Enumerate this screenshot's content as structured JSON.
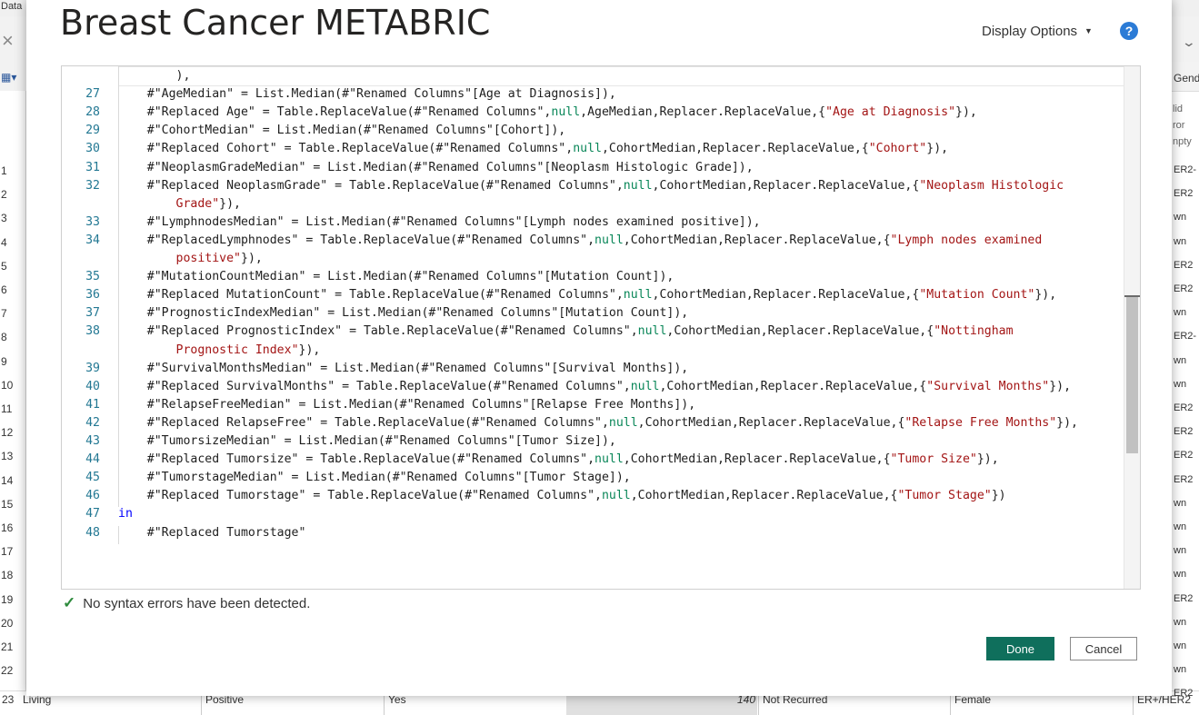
{
  "background": {
    "topbar_label": "Data",
    "close_glyph": "×",
    "table_icon": "▦▾",
    "row_numbers": [
      "1",
      "2",
      "3",
      "4",
      "5",
      "6",
      "7",
      "8",
      "9",
      "10",
      "11",
      "12",
      "13",
      "14",
      "15",
      "16",
      "17",
      "18",
      "19",
      "20",
      "21",
      "22"
    ],
    "right_column_header": "Gend",
    "right_column_mini": [
      "lid",
      "ror",
      "npty"
    ],
    "right_column_cells": [
      "ER2-",
      "ER2",
      "wn",
      "wn",
      "ER2",
      "ER2",
      "wn",
      "ER2-",
      "wn",
      "wn",
      "ER2",
      "ER2",
      "ER2",
      "ER2",
      "wn",
      "wn",
      "wn",
      "wn",
      "ER2",
      "wn",
      "wn",
      "wn",
      "ER2"
    ],
    "bottom_row": {
      "row_number": "23",
      "status": "Living",
      "receptor": "Positive",
      "flag": "Yes",
      "value": "140",
      "recurrence": "Not Recurred",
      "sex": "Female",
      "subtype": "ER+/HER2"
    }
  },
  "dialog": {
    "title": "Breast Cancer METABRIC",
    "display_options_label": "Display Options",
    "help_label": "?",
    "status_text": "No syntax errors have been detected.",
    "done_label": "Done",
    "cancel_label": "Cancel",
    "code_lines": [
      {
        "n": "",
        "parts": [
          [
            "        ),",
            ""
          ]
        ]
      },
      {
        "n": "27",
        "parts": [
          [
            "    #\"AgeMedian\" = List.Median(#\"Renamed Columns\"[Age at Diagnosis]),",
            ""
          ]
        ]
      },
      {
        "n": "28",
        "parts": [
          [
            "    #\"Replaced Age\" = Table.ReplaceValue(#\"Renamed Columns\",",
            ""
          ],
          [
            "null",
            "nl"
          ],
          [
            ",AgeMedian,Replacer.ReplaceValue,{",
            ""
          ],
          [
            "\"Age at Diagnosis\"",
            "st"
          ],
          [
            "}),",
            ""
          ]
        ]
      },
      {
        "n": "29",
        "parts": [
          [
            "    #\"CohortMedian\" = List.Median(#\"Renamed Columns\"[Cohort]),",
            ""
          ]
        ]
      },
      {
        "n": "30",
        "parts": [
          [
            "    #\"Replaced Cohort\" = Table.ReplaceValue(#\"Renamed Columns\",",
            ""
          ],
          [
            "null",
            "nl"
          ],
          [
            ",CohortMedian,Replacer.ReplaceValue,{",
            ""
          ],
          [
            "\"Cohort\"",
            "st"
          ],
          [
            "}),",
            ""
          ]
        ]
      },
      {
        "n": "31",
        "parts": [
          [
            "    #\"NeoplasmGradeMedian\" = List.Median(#\"Renamed Columns\"[Neoplasm Histologic Grade]),",
            ""
          ]
        ]
      },
      {
        "n": "32",
        "parts": [
          [
            "    #\"Replaced NeoplasmGrade\" = Table.ReplaceValue(#\"Renamed Columns\",",
            ""
          ],
          [
            "null",
            "nl"
          ],
          [
            ",CohortMedian,Replacer.ReplaceValue,{",
            ""
          ],
          [
            "\"Neoplasm Histologic",
            "st"
          ]
        ]
      },
      {
        "n": "",
        "parts": [
          [
            "        ",
            ""
          ],
          [
            "Grade\"",
            "st"
          ],
          [
            "}),",
            ""
          ]
        ]
      },
      {
        "n": "33",
        "parts": [
          [
            "    #\"LymphnodesMedian\" = List.Median(#\"Renamed Columns\"[Lymph nodes examined positive]),",
            ""
          ]
        ]
      },
      {
        "n": "34",
        "parts": [
          [
            "    #\"ReplacedLymphnodes\" = Table.ReplaceValue(#\"Renamed Columns\",",
            ""
          ],
          [
            "null",
            "nl"
          ],
          [
            ",CohortMedian,Replacer.ReplaceValue,{",
            ""
          ],
          [
            "\"Lymph nodes examined",
            "st"
          ]
        ]
      },
      {
        "n": "",
        "parts": [
          [
            "        ",
            ""
          ],
          [
            "positive\"",
            "st"
          ],
          [
            "}),",
            ""
          ]
        ]
      },
      {
        "n": "35",
        "parts": [
          [
            "    #\"MutationCountMedian\" = List.Median(#\"Renamed Columns\"[Mutation Count]),",
            ""
          ]
        ]
      },
      {
        "n": "36",
        "parts": [
          [
            "    #\"Replaced MutationCount\" = Table.ReplaceValue(#\"Renamed Columns\",",
            ""
          ],
          [
            "null",
            "nl"
          ],
          [
            ",CohortMedian,Replacer.ReplaceValue,{",
            ""
          ],
          [
            "\"Mutation Count\"",
            "st"
          ],
          [
            "}),",
            ""
          ]
        ]
      },
      {
        "n": "37",
        "parts": [
          [
            "    #\"PrognosticIndexMedian\" = List.Median(#\"Renamed Columns\"[Mutation Count]),",
            ""
          ]
        ]
      },
      {
        "n": "38",
        "parts": [
          [
            "    #\"Replaced PrognosticIndex\" = Table.ReplaceValue(#\"Renamed Columns\",",
            ""
          ],
          [
            "null",
            "nl"
          ],
          [
            ",CohortMedian,Replacer.ReplaceValue,{",
            ""
          ],
          [
            "\"Nottingham",
            "st"
          ]
        ]
      },
      {
        "n": "",
        "parts": [
          [
            "        ",
            ""
          ],
          [
            "Prognostic Index\"",
            "st"
          ],
          [
            "}),",
            ""
          ]
        ]
      },
      {
        "n": "39",
        "parts": [
          [
            "    #\"SurvivalMonthsMedian\" = List.Median(#\"Renamed Columns\"[Survival Months]),",
            ""
          ]
        ]
      },
      {
        "n": "40",
        "parts": [
          [
            "    #\"Replaced SurvivalMonths\" = Table.ReplaceValue(#\"Renamed Columns\",",
            ""
          ],
          [
            "null",
            "nl"
          ],
          [
            ",CohortMedian,Replacer.ReplaceValue,{",
            ""
          ],
          [
            "\"Survival Months\"",
            "st"
          ],
          [
            "}),",
            ""
          ]
        ]
      },
      {
        "n": "41",
        "parts": [
          [
            "    #\"RelapseFreeMedian\" = List.Median(#\"Renamed Columns\"[Relapse Free Months]),",
            ""
          ]
        ]
      },
      {
        "n": "42",
        "parts": [
          [
            "    #\"Replaced RelapseFree\" = Table.ReplaceValue(#\"Renamed Columns\",",
            ""
          ],
          [
            "null",
            "nl"
          ],
          [
            ",CohortMedian,Replacer.ReplaceValue,{",
            ""
          ],
          [
            "\"Relapse Free Months\"",
            "st"
          ],
          [
            "}),",
            ""
          ]
        ]
      },
      {
        "n": "43",
        "parts": [
          [
            "    #\"TumorsizeMedian\" = List.Median(#\"Renamed Columns\"[Tumor Size]),",
            ""
          ]
        ]
      },
      {
        "n": "44",
        "parts": [
          [
            "    #\"Replaced Tumorsize\" = Table.ReplaceValue(#\"Renamed Columns\",",
            ""
          ],
          [
            "null",
            "nl"
          ],
          [
            ",CohortMedian,Replacer.ReplaceValue,{",
            ""
          ],
          [
            "\"Tumor Size\"",
            "st"
          ],
          [
            "}),",
            ""
          ]
        ]
      },
      {
        "n": "45",
        "parts": [
          [
            "    #\"TumorstageMedian\" = List.Median(#\"Renamed Columns\"[Tumor Stage]),",
            ""
          ]
        ]
      },
      {
        "n": "46",
        "parts": [
          [
            "    #\"Replaced Tumorstage\" = Table.ReplaceValue(#\"Renamed Columns\",",
            ""
          ],
          [
            "null",
            "nl"
          ],
          [
            ",CohortMedian,Replacer.ReplaceValue,{",
            ""
          ],
          [
            "\"Tumor Stage\"",
            "st"
          ],
          [
            "})",
            ""
          ]
        ]
      },
      {
        "n": "47",
        "parts": [
          [
            "in",
            "kw"
          ]
        ]
      },
      {
        "n": "48",
        "parts": [
          [
            "    #\"Replaced Tumorstage\"",
            ""
          ]
        ]
      }
    ]
  },
  "colors": {
    "done_button": "#0f6f5c",
    "keyword": "#0000ff",
    "null_literal": "#098658",
    "string_literal": "#a31515",
    "line_number": "#237893",
    "check": "#2e8b3d",
    "help_icon": "#2b7bd6"
  },
  "icons": {
    "help": "help-circle-icon",
    "status": "checkmark-icon",
    "dropdown": "caret-down-icon"
  }
}
